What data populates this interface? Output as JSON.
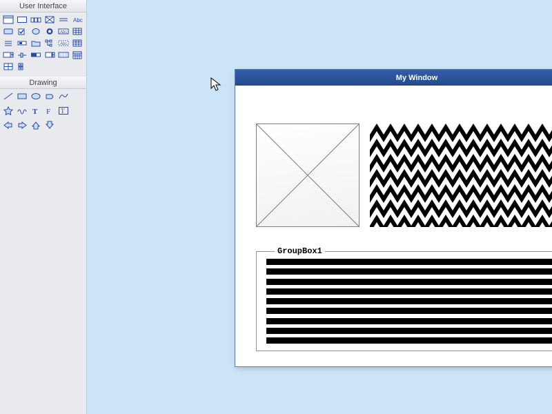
{
  "palette": {
    "section_ui": "User Interface",
    "section_draw": "Drawing",
    "ui_tools": [
      "window",
      "panel",
      "tabbar",
      "image",
      "double-line",
      "label-abc",
      "button",
      "checkbox",
      "radio-outline",
      "radio-filled",
      "input-abc",
      "grid",
      "menu",
      "scrollbar-h",
      "folder",
      "tree",
      "input-abc-dash",
      "table",
      "dropdown",
      "slider",
      "progress",
      "spinner",
      "toolbar",
      "calendar",
      "grid2",
      "stepper"
    ],
    "draw_tools": [
      "line",
      "rect",
      "ellipse",
      "polygon",
      "curve",
      "star",
      "squiggle",
      "text-bold",
      "text-plain",
      "text-frame",
      "arrow-left",
      "arrow-right",
      "arrow-up",
      "arrow-down"
    ]
  },
  "window": {
    "title": "My Window",
    "groupbox_label": "GroupBox1"
  },
  "colors": {
    "tool_stroke": "#2a4aa8",
    "tool_fill_light": "#c9ddf5",
    "accent": "#335ea8"
  }
}
